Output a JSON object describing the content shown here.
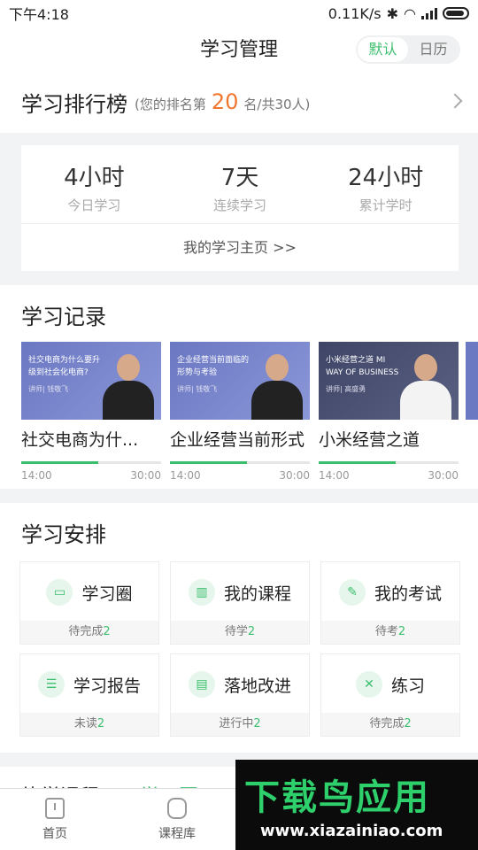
{
  "status": {
    "time": "下午4:18",
    "speed": "0.11K/s"
  },
  "nav": {
    "title": "学习管理",
    "seg": [
      "默认",
      "日历"
    ]
  },
  "rank": {
    "title": "学习排行榜",
    "prefix": "(您的排名第",
    "number": "20",
    "suffix": "名/共30人)"
  },
  "stats": {
    "items": [
      {
        "value": "4小时",
        "label": "今日学习"
      },
      {
        "value": "7天",
        "label": "连续学习"
      },
      {
        "value": "24小时",
        "label": "累计学时"
      }
    ],
    "link": "我的学习主页 >>"
  },
  "records": {
    "title": "学习记录",
    "items": [
      {
        "title": "社交电商为什...",
        "thumb_text": "社交电商为什么要升级到社会化电商?",
        "thumb_sub": "讲师| 钱敬飞",
        "progress": 0.55,
        "start": "14:00",
        "end": "30:00"
      },
      {
        "title": "企业经营当前形式",
        "thumb_text": "企业经营当前面临的形势与考验",
        "thumb_sub": "讲师| 钱敬飞",
        "progress": 0.55,
        "start": "14:00",
        "end": "30:00"
      },
      {
        "title": "小米经营之道",
        "thumb_text": "小米经营之道 MI WAY OF BUSINESS",
        "thumb_sub": "讲师| 高盛勇",
        "progress": 0.55,
        "start": "14:00",
        "end": "30:00"
      }
    ]
  },
  "schedule": {
    "title": "学习安排",
    "tiles": [
      {
        "label": "学习圈",
        "status": "待完成",
        "count": "2"
      },
      {
        "label": "我的课程",
        "status": "待学",
        "count": "2"
      },
      {
        "label": "我的考试",
        "status": "待考",
        "count": "2"
      },
      {
        "label": "学习报告",
        "status": "未读",
        "count": "2"
      },
      {
        "label": "落地改进",
        "status": "进行中",
        "count": "2"
      },
      {
        "label": "练习",
        "status": "待完成",
        "count": "2"
      }
    ]
  },
  "next_section": {
    "title": "练学课程",
    "link": "学习圈"
  },
  "tabbar": {
    "items": [
      "首页",
      "课程库"
    ]
  },
  "watermark": {
    "title": "下载鸟应用",
    "url": "www.xiazainiao.com"
  }
}
